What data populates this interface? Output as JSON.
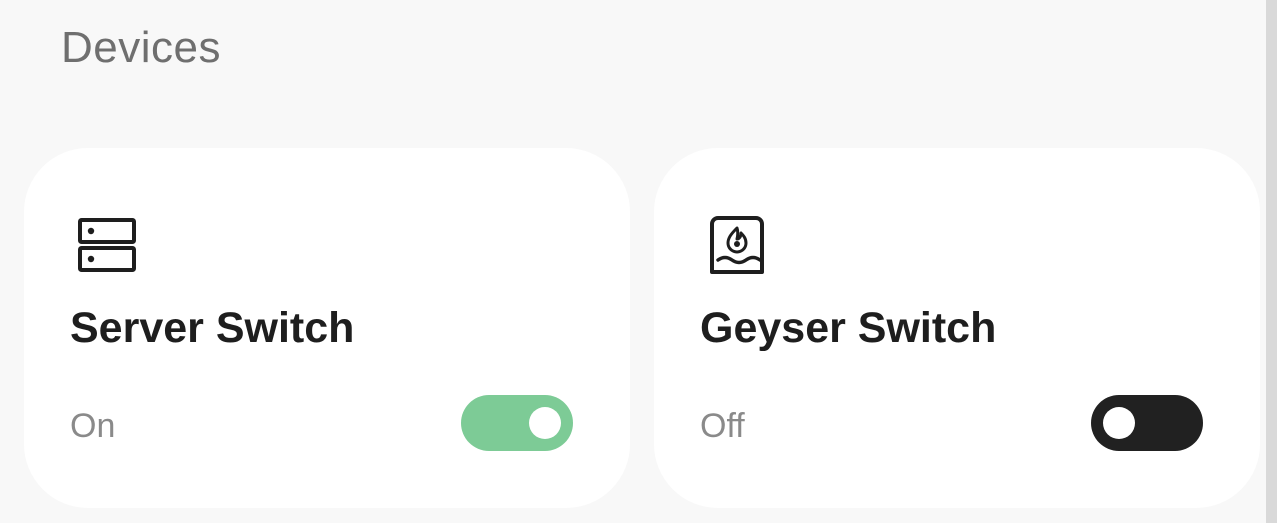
{
  "section": {
    "title": "Devices"
  },
  "devices": [
    {
      "name": "Server Switch",
      "icon": "server-icon",
      "state_label": "On",
      "is_on": true,
      "toggle_color": "#7dcb96"
    },
    {
      "name": "Geyser Switch",
      "icon": "water-heater-icon",
      "state_label": "Off",
      "is_on": false,
      "toggle_color": "#212121"
    }
  ]
}
